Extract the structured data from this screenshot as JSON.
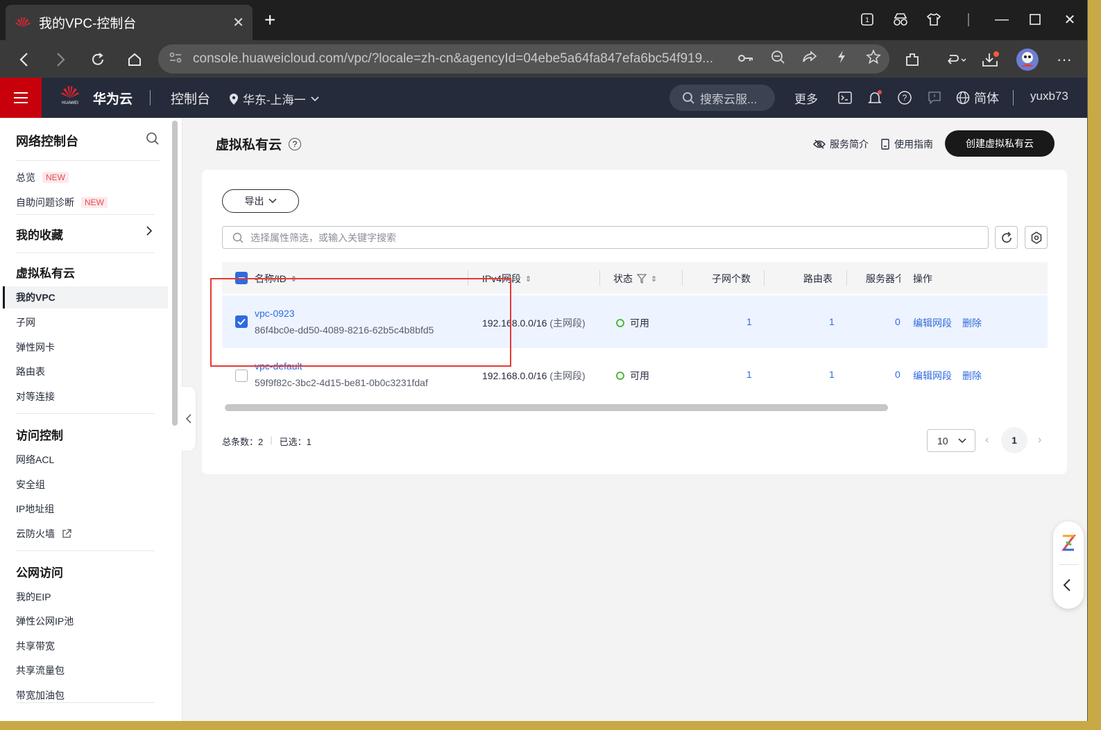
{
  "browser": {
    "tab_title": "我的VPC-控制台",
    "url": "console.huaweicloud.com/vpc/?locale=zh-cn&agencyId=04ebe5a64fa847efa6bc54f919..."
  },
  "header": {
    "brand": "华为云",
    "brand_logo_text": "HUAWEI",
    "console": "控制台",
    "region": "华东-上海一",
    "search_placeholder": "搜索云服...",
    "more": "更多",
    "language": "简体",
    "user": "yuxb73"
  },
  "sidebar": {
    "title": "网络控制台",
    "new_badge": "NEW",
    "overview": "总览",
    "diagnose": "自助问题诊断",
    "favorites": "我的收藏",
    "groups": [
      {
        "title": "虚拟私有云",
        "items": [
          "我的VPC",
          "子网",
          "弹性网卡",
          "路由表",
          "对等连接"
        ]
      },
      {
        "title": "访问控制",
        "items": [
          "网络ACL",
          "安全组",
          "IP地址组",
          "云防火墙"
        ]
      },
      {
        "title": "公网访问",
        "items": [
          "我的EIP",
          "弹性公网IP池",
          "共享带宽",
          "共享流量包",
          "带宽加油包"
        ]
      }
    ]
  },
  "main": {
    "title": "虚拟私有云",
    "service_intro": "服务简介",
    "user_guide": "使用指南",
    "create_button": "创建虚拟私有云",
    "export": "导出",
    "filter_placeholder": "选择属性筛选，或输入关键字搜索"
  },
  "table": {
    "columns": [
      "名称/ID",
      "IPv4网段",
      "状态",
      "子网个数",
      "路由表",
      "服务器个",
      "操作"
    ],
    "rows": [
      {
        "name": "vpc-0923",
        "id": "86f4bc0e-dd50-4089-8216-62b5c4b8bfd5",
        "cidr": "192.168.0.0/16",
        "cidr_note": "(主网段)",
        "status": "可用",
        "subnets": "1",
        "route_tables": "1",
        "servers": "0",
        "action_edit": "编辑网段",
        "action_delete": "删除",
        "selected": true
      },
      {
        "name": "vpc-default",
        "id": "59f9f82c-3bc2-4d15-be81-0b0c3231fdaf",
        "cidr": "192.168.0.0/16",
        "cidr_note": "(主网段)",
        "status": "可用",
        "subnets": "1",
        "route_tables": "1",
        "servers": "0",
        "action_edit": "编辑网段",
        "action_delete": "删除",
        "selected": false
      }
    ]
  },
  "footer": {
    "total": "总条数：2",
    "selected": "已选：1",
    "page_size": "10",
    "current_page": "1"
  },
  "colors": {
    "header_bg": "#252b3a",
    "menu_red": "#c7000b",
    "link_blue": "#2f6bdf",
    "status_green": "#50b83c",
    "annotation_red": "#e53935"
  }
}
